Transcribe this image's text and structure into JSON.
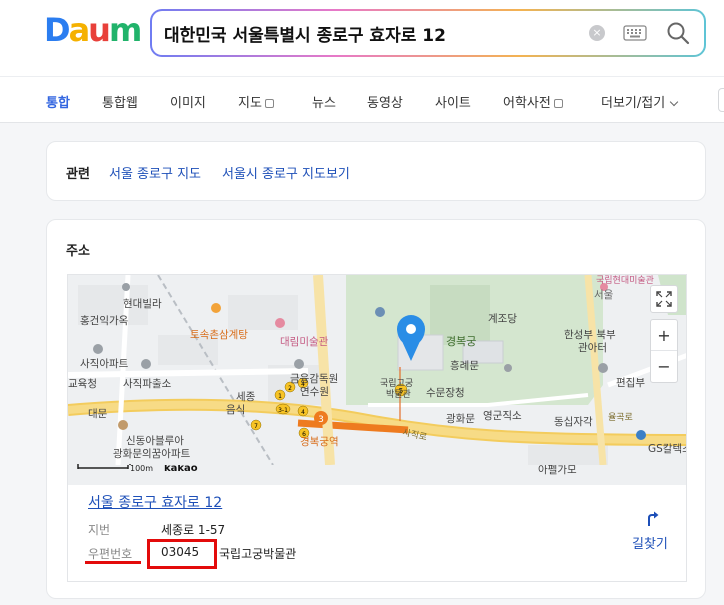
{
  "logo": {
    "text": [
      "D",
      "a",
      "u",
      "m"
    ],
    "colors": [
      "#2b7df0",
      "#f5b100",
      "#e8403a",
      "#21b36b"
    ]
  },
  "search": {
    "query": "대한민국 서울특별시 종로구 효자로 12",
    "clear": "×"
  },
  "tabs": [
    {
      "label": "통합",
      "active": true
    },
    {
      "label": "통합웹"
    },
    {
      "label": "이미지"
    },
    {
      "label": "지도"
    },
    {
      "label": "뉴스"
    },
    {
      "label": "동영상"
    },
    {
      "label": "사이트"
    },
    {
      "label": "어학사전"
    },
    {
      "label": "더보기/접기"
    }
  ],
  "related": {
    "title": "관련",
    "links": [
      "서울 종로구 지도",
      "서울시 종로구 지도보기"
    ]
  },
  "address": {
    "title": "주소",
    "place_name": "서울 종로구 효자로 12",
    "jibun_label": "지번",
    "jibun_value": "세종로 1-57",
    "postal_label": "우편번호",
    "postal_code": "03045",
    "building": "국립고궁박물관",
    "route_label": "길찾기"
  },
  "map": {
    "labels": {
      "hyundai": "현대빌라",
      "hongkun": "홍건익가옥",
      "tosok": "토속촌삼계탕",
      "daelim": "대림미술관",
      "sajik_apt": "사직아파트",
      "gyoyuk": "교육청",
      "sajik_police": "사직파출소",
      "geumyung1": "금융감독원",
      "geumyung2": "연수원",
      "sejong": "세종",
      "eumsik": "음식",
      "museum1": "국립고궁",
      "museum2": "박물관",
      "gyebok": "경복궁",
      "jejodang": "계조당",
      "heungrye": "흥례문",
      "sumun": "수문장청",
      "gwanghwa": "광화문",
      "yeonggun": "영군직소",
      "dongsip": "동십자각",
      "hansung1": "한성부 북부",
      "hansung2": "관아터",
      "pyeonjip": "편집부",
      "daemun": "대문",
      "sindong": "신동아블루아",
      "gwanghwa_apt": "광화문의꿈아파트",
      "gyeongbok_station": "경복궁역",
      "sajik_ro": "사직로",
      "yulgok": "율곡로",
      "gs": "GS칼텍스",
      "apel": "아펠가모",
      "seoul": "서울",
      "folk": "국립현대미술관",
      "scale": "100m",
      "kakao": "kakao"
    },
    "controls": {
      "zoom_in": "+",
      "zoom_out": "−"
    }
  }
}
